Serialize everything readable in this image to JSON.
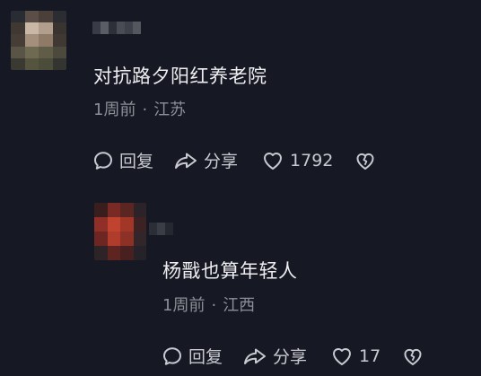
{
  "comments": [
    {
      "text": "对抗路夕阳红养老院",
      "time": "1周前",
      "separator": "·",
      "location": "江苏",
      "reply_label": "回复",
      "share_label": "分享",
      "like_count": "1792"
    },
    {
      "text": "杨戬也算年轻人",
      "time": "1周前",
      "separator": "·",
      "location": "江西",
      "reply_label": "回复",
      "share_label": "分享",
      "like_count": "17"
    }
  ],
  "icons": {
    "reply": "comment-bubble-icon",
    "share": "share-arrow-icon",
    "like": "heart-icon",
    "dislike": "broken-heart-icon"
  },
  "colors": {
    "background": "#161823",
    "text": "#eeeef0",
    "meta": "#8d8f97",
    "action": "#c9cad0"
  }
}
